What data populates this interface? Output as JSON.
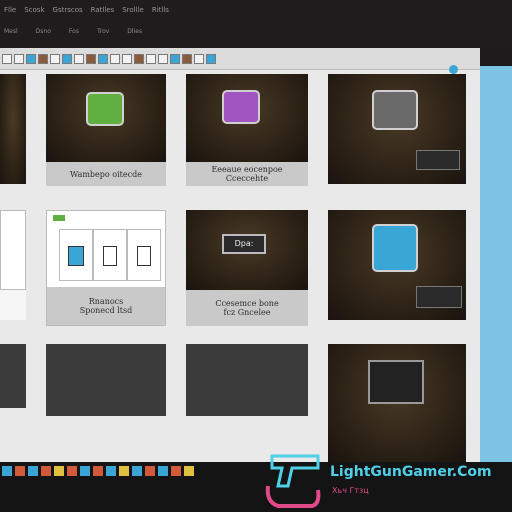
{
  "menu": {
    "items": [
      "Flle",
      "Scosk",
      "Gstrscos",
      "Ratlles",
      "Srollle",
      "Ritlls"
    ]
  },
  "submenu": {
    "items": [
      "Mesl",
      "Dsno",
      "Fos",
      "Trov",
      "Dlies"
    ]
  },
  "cards": [
    {
      "caption_line1": "",
      "caption_line2": ""
    },
    {
      "caption_line1": "Wambepo oitecde",
      "caption_line2": ""
    },
    {
      "caption_line1": "Eeeaue eocenpoe",
      "caption_line2": "Cceccehte"
    },
    {
      "caption_line1": "",
      "caption_line2": ""
    },
    {
      "caption_line1": "",
      "caption_line2": ""
    },
    {
      "caption_line1": "Rnanocs",
      "caption_line2": "Sponecd ltsd"
    },
    {
      "caption_line1": "",
      "caption_line2": ""
    },
    {
      "caption_line1": "Ccesemce bone",
      "caption_line2": "fcz Gncelee"
    },
    {
      "caption_line1": "",
      "caption_line2": ""
    },
    {
      "caption_line1": "",
      "caption_line2": ""
    },
    {
      "caption_line1": "",
      "caption_line2": ""
    },
    {
      "caption_line1": "",
      "caption_line2": ""
    }
  ],
  "badge": {
    "label": "Dpa:"
  },
  "watermark": {
    "title": "LightGunGamer.Com",
    "subtitle": "Хьч Гтзц"
  },
  "colors": {
    "accent": "#3aa6d6",
    "panel": "#7cc3e6",
    "card_caption": "#c9c9c9"
  }
}
